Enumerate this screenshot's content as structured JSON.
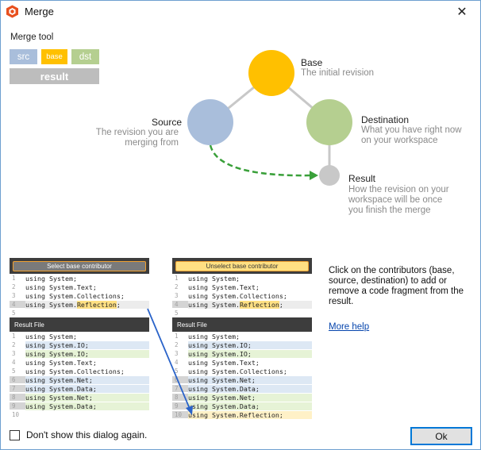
{
  "window": {
    "title": "Merge",
    "close_glyph": "✕"
  },
  "merge_tool": {
    "title": "Merge tool",
    "chips": {
      "src": "src",
      "base": "base",
      "dst": "dst",
      "result": "result"
    }
  },
  "diagram": {
    "base": {
      "title": "Base",
      "desc": [
        "The initial revision"
      ]
    },
    "source": {
      "title": "Source",
      "desc": [
        "The revision you are",
        "merging from"
      ]
    },
    "destination": {
      "title": "Destination",
      "desc": [
        "What you have right now",
        "on your workspace"
      ]
    },
    "result": {
      "title": "Result",
      "desc": [
        "How the revision on your",
        "workspace will be once",
        "you finish the merge"
      ]
    }
  },
  "left_panel": {
    "button": "Select base contributor",
    "code": [
      {
        "n": "1",
        "pre": "using System;",
        "word": "",
        "post": ""
      },
      {
        "n": "2",
        "pre": "using System.Text;",
        "word": "",
        "post": ""
      },
      {
        "n": "3",
        "pre": "using System.Collections;",
        "word": "",
        "post": ""
      },
      {
        "n": "4",
        "pre": "using System.",
        "word": "Reflection",
        "post": ";"
      },
      {
        "n": "5",
        "pre": "",
        "word": "",
        "post": ""
      }
    ],
    "result_header": "Result File",
    "result": [
      {
        "n": "1",
        "text": "using System;"
      },
      {
        "n": "2",
        "text": "using System.IO;"
      },
      {
        "n": "3",
        "text": "using System.IO;"
      },
      {
        "n": "4",
        "text": "using System.Text;"
      },
      {
        "n": "5",
        "text": "using System.Collections;"
      },
      {
        "n": "6",
        "text": "using System.Net;"
      },
      {
        "n": "7",
        "text": "using System.Data;"
      },
      {
        "n": "8",
        "text": "using System.Net;"
      },
      {
        "n": "9",
        "text": "using System.Data;"
      },
      {
        "n": "10",
        "text": ""
      }
    ]
  },
  "right_panel": {
    "button": "Unselect base contributor",
    "code": [
      {
        "n": "1",
        "pre": "using System;",
        "word": "",
        "post": ""
      },
      {
        "n": "2",
        "pre": "using System.Text;",
        "word": "",
        "post": ""
      },
      {
        "n": "3",
        "pre": "using System.Collections;",
        "word": "",
        "post": ""
      },
      {
        "n": "4",
        "pre": "using System.",
        "word": "Reflection",
        "post": ";"
      },
      {
        "n": "5",
        "pre": "",
        "word": "",
        "post": ""
      }
    ],
    "result_header": "Result File",
    "result": [
      {
        "n": "1",
        "text": "using System;"
      },
      {
        "n": "2",
        "text": "using System.IO;"
      },
      {
        "n": "3",
        "text": "using System.IO;"
      },
      {
        "n": "4",
        "text": "using System.Text;"
      },
      {
        "n": "5",
        "text": "using System.Collections;"
      },
      {
        "n": "6",
        "text": "using System.Net;"
      },
      {
        "n": "7",
        "text": "using System.Data;"
      },
      {
        "n": "8",
        "text": "using System.Net;"
      },
      {
        "n": "9",
        "text": "using System.Data;"
      },
      {
        "n": "10",
        "text": "using System.Reflection;"
      }
    ]
  },
  "help": {
    "text": "Click on the contributors (base, source, destination) to add or remove a code fragment from the result.",
    "more_help": "More help"
  },
  "footer": {
    "checkbox_label": "Don't show this dialog again.",
    "ok_label": "Ok"
  },
  "colors": {
    "base": "#ffc000",
    "source": "#a9bedb",
    "destination": "#b5cf90",
    "result": "#c8c8c8",
    "arrow": "#3aa03a",
    "accent": "#0078d7"
  }
}
